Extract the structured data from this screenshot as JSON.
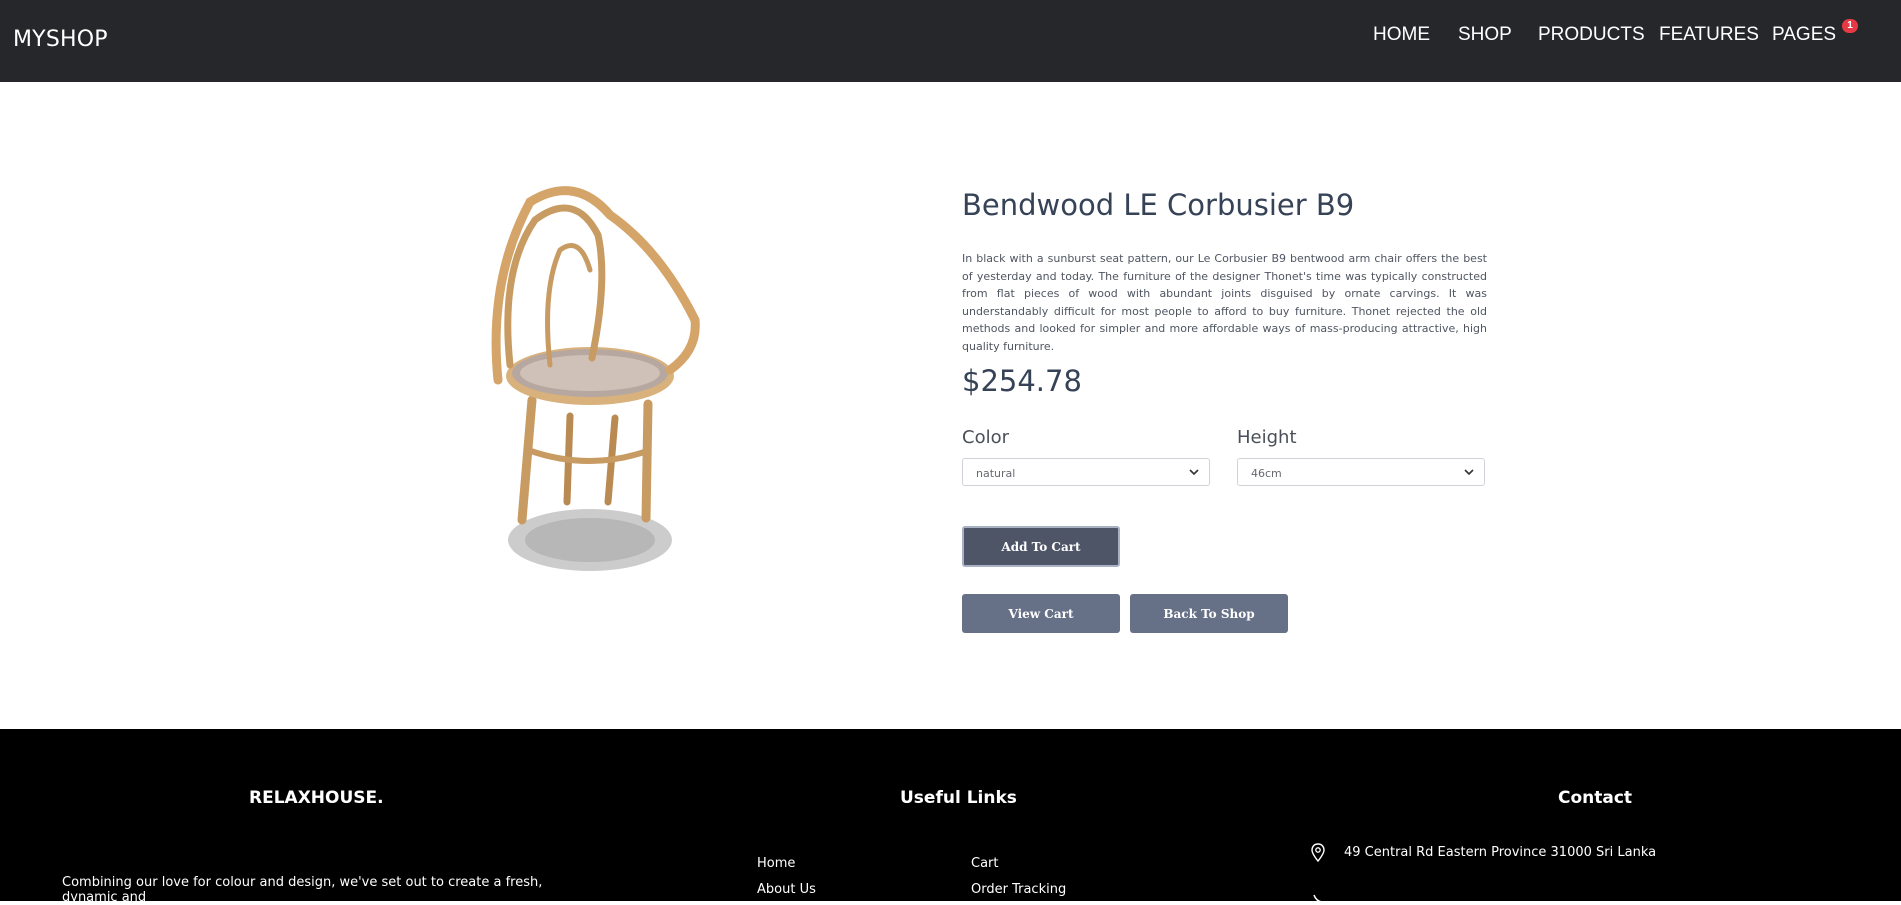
{
  "nav": {
    "brand": "MYSHOP",
    "items": [
      "HOME",
      "SHOP",
      "PRODUCTS",
      "FEATURES",
      "PAGES"
    ],
    "badge": "1"
  },
  "product": {
    "title": "Bendwood LE Corbusier B9",
    "description": "In black with a sunburst seat pattern, our Le Corbusier B9 bentwood arm chair offers the best of yesterday and today. The furniture of the designer Thonet's time was typically constructed from flat pieces of wood with abundant joints disguised by ornate carvings. It was understandably difficult for most people to afford to buy furniture. Thonet rejected the old methods and looked for simpler and more affordable ways of mass-producing attractive, high quality furniture.",
    "price": "$254.78",
    "color_label": "Color",
    "color_value": "natural",
    "height_label": "Height",
    "height_value": "46cm"
  },
  "actions": {
    "add_to_cart": "Add To Cart",
    "view_cart": "View Cart",
    "back_to_shop": "Back To Shop"
  },
  "footer": {
    "brand": "RELAXHOUSE.",
    "about": "Combining our love for colour and design, we've set out to create a fresh, dynamic and",
    "links_title": "Useful Links",
    "links_col1": [
      "Home",
      "About Us"
    ],
    "links_col2": [
      "Cart",
      "Order Tracking"
    ],
    "contact_title": "Contact",
    "address": "49 Central Rd Eastern Province 31000 Sri Lanka"
  },
  "colors": {
    "navbar": "#25272a",
    "footer": "#000000",
    "button": "#667086",
    "badge": "#e53a45"
  }
}
